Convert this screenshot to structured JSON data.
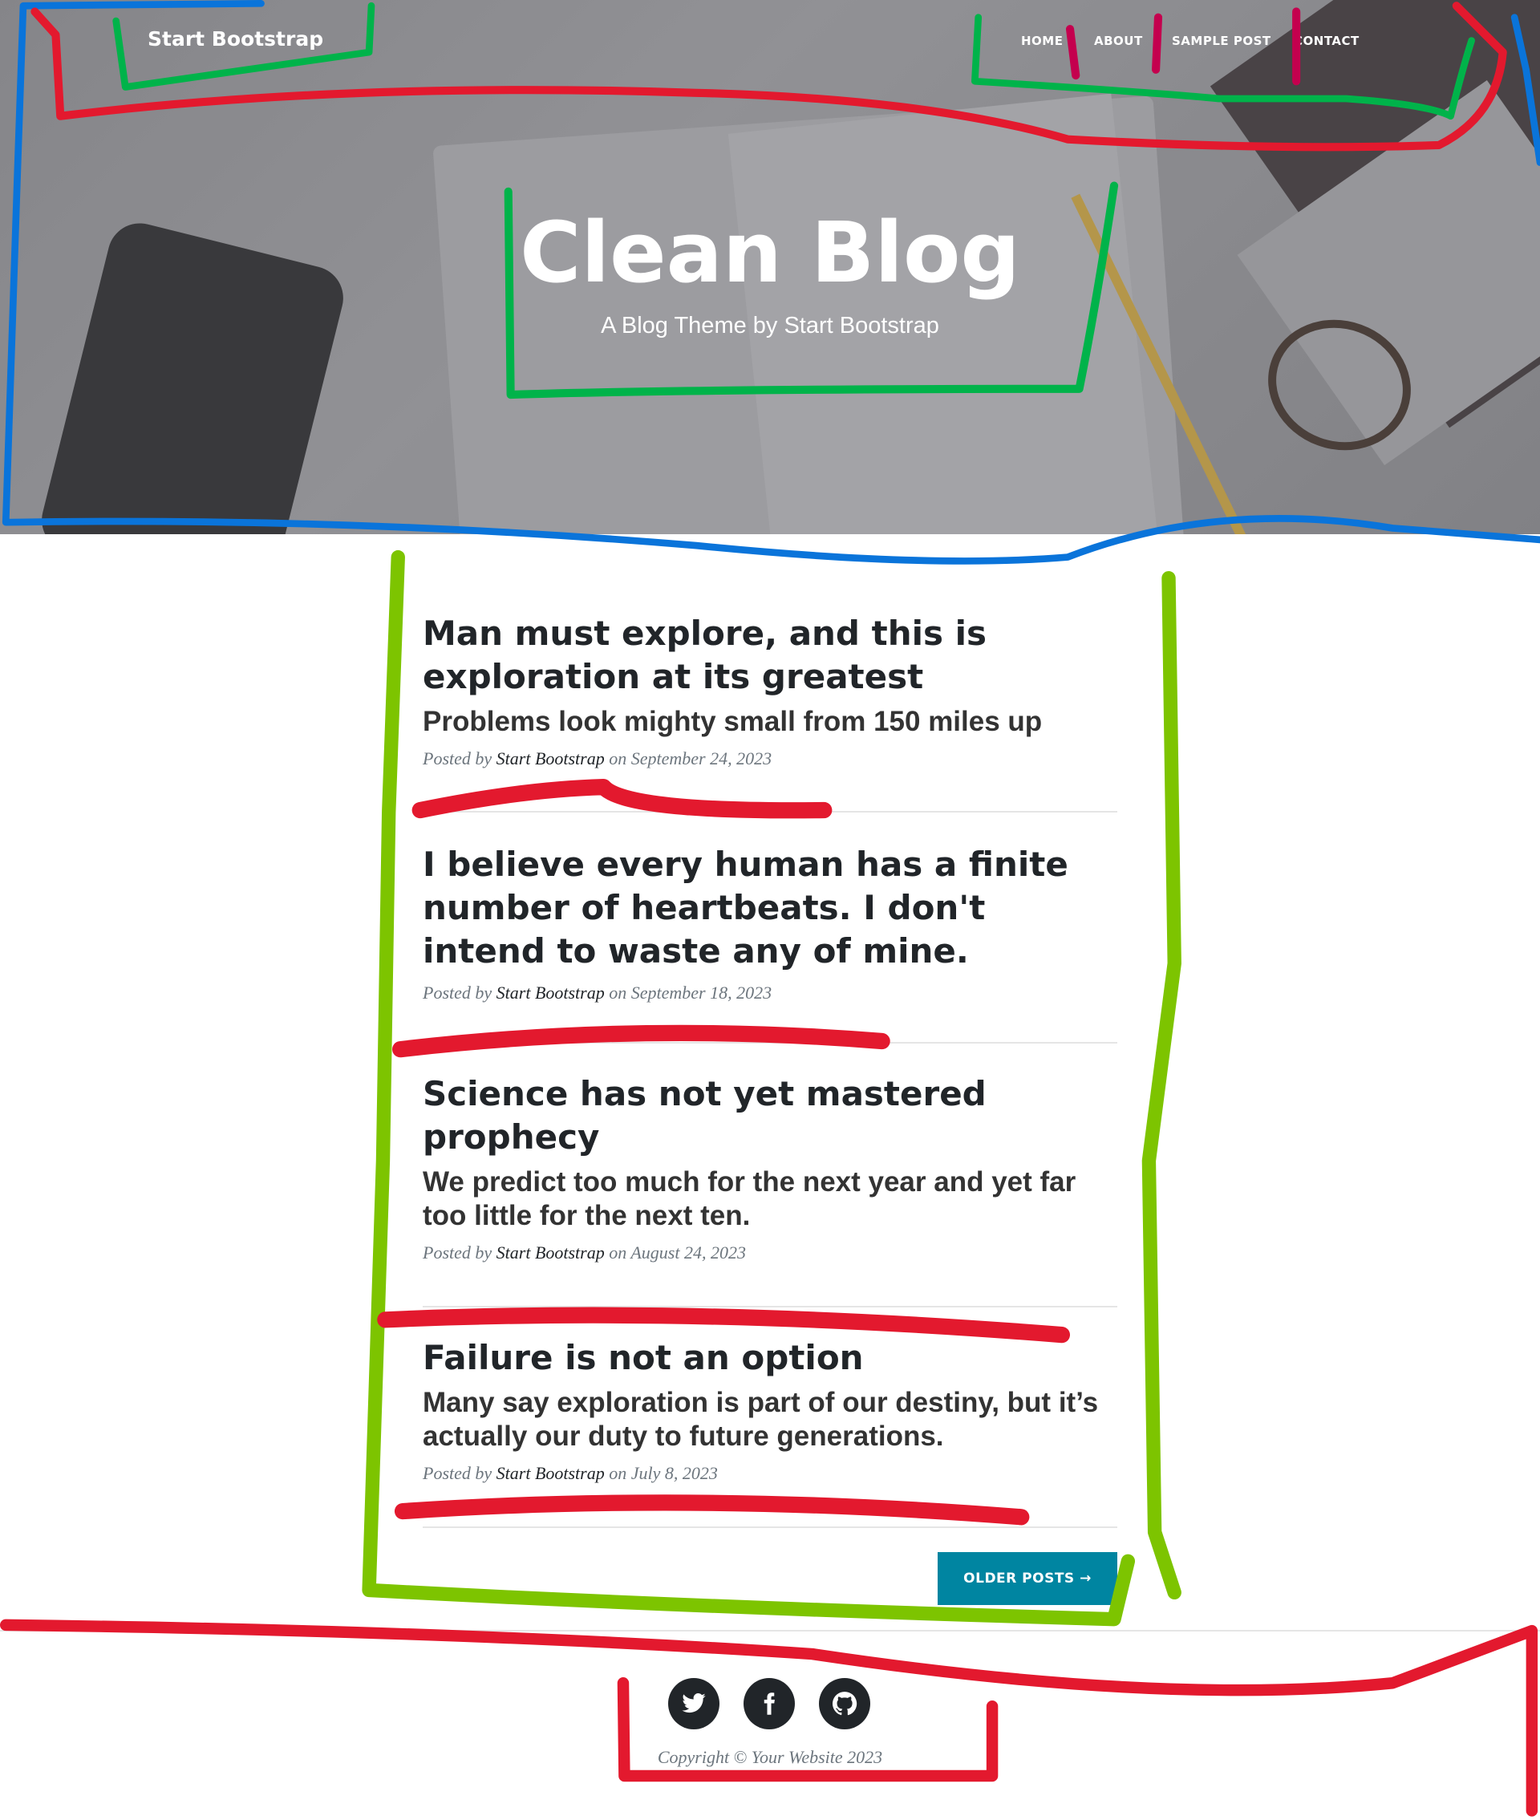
{
  "nav": {
    "brand": "Start Bootstrap",
    "items": [
      "HOME",
      "ABOUT",
      "SAMPLE POST",
      "CONTACT"
    ]
  },
  "header": {
    "title": "Clean Blog",
    "subtitle": "A Blog Theme by Start Bootstrap"
  },
  "posts": [
    {
      "title": "Man must explore, and this is exploration at its greatest",
      "subtitle": "Problems look mighty small from 150 miles up",
      "posted_by": "Posted by",
      "author": "Start Bootstrap",
      "on": "on September 24, 2023"
    },
    {
      "title": "I believe every human has a finite number of heartbeats. I don't intend to waste any of mine.",
      "posted_by": "Posted by",
      "author": "Start Bootstrap",
      "on": "on September 18, 2023"
    },
    {
      "title": "Science has not yet mastered prophecy",
      "subtitle": "We predict too much for the next year and yet far too little for the next ten.",
      "posted_by": "Posted by",
      "author": "Start Bootstrap",
      "on": "on August 24, 2023"
    },
    {
      "title": "Failure is not an option",
      "subtitle": "Many say exploration is part of our destiny, but it’s actually our duty to future generations.",
      "posted_by": "Posted by",
      "author": "Start Bootstrap",
      "on": "on July 8, 2023"
    }
  ],
  "pager": {
    "older": "OLDER POSTS →"
  },
  "footer": {
    "icons": [
      "twitter-icon",
      "facebook-icon",
      "github-icon"
    ],
    "copyright": "Copyright © Your Website 2023"
  },
  "colors": {
    "accent": "#0085a1",
    "text": "#212529"
  }
}
